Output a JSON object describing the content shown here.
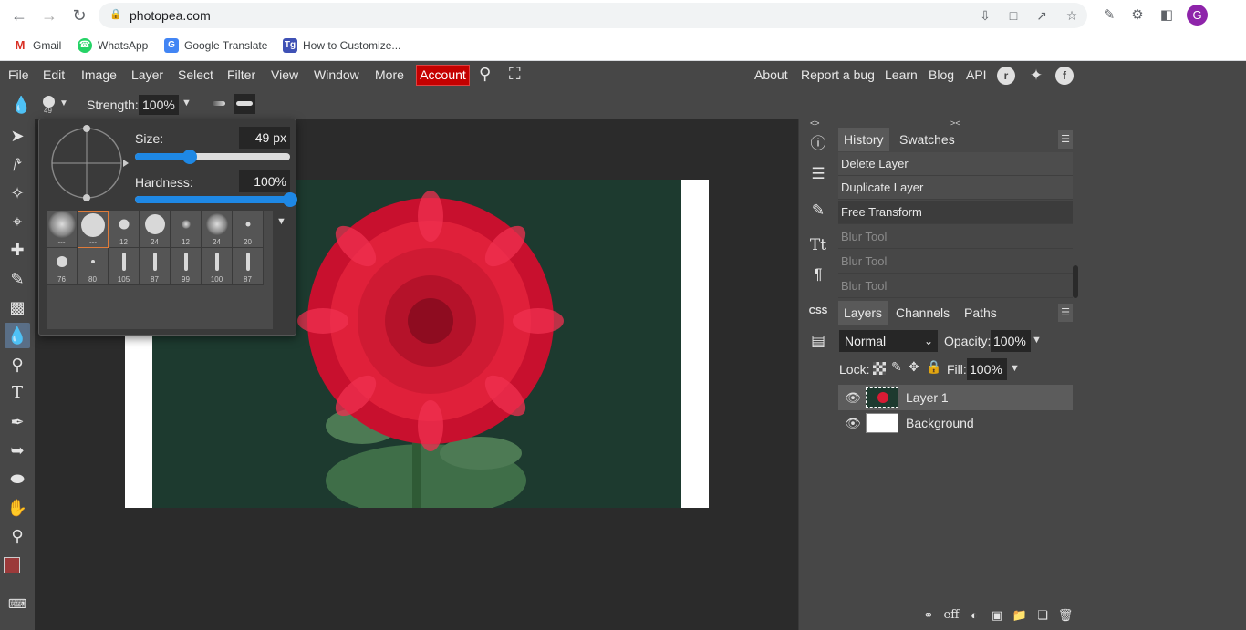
{
  "browser": {
    "url": "photopea.com",
    "profile_initial": "G",
    "bookmarks": [
      {
        "label": "Gmail",
        "icon": "gmail-icon"
      },
      {
        "label": "WhatsApp",
        "icon": "whatsapp-icon"
      },
      {
        "label": "Google Translate",
        "icon": "google-translate-icon"
      },
      {
        "label": "How to Customize...",
        "icon": "tg-icon"
      }
    ]
  },
  "menu": {
    "items": [
      "File",
      "Edit",
      "Image",
      "Layer",
      "Select",
      "Filter",
      "View",
      "Window",
      "More"
    ],
    "account": "Account",
    "right_links": [
      "About",
      "Report a bug",
      "Learn",
      "Blog",
      "API"
    ]
  },
  "options": {
    "brush_size_badge": "49",
    "strength_label": "Strength:",
    "strength_value": "100%"
  },
  "brush_popup": {
    "size_label": "Size:",
    "size_value": "49  px",
    "size_fraction": 0.35,
    "hardness_label": "Hardness:",
    "hardness_value": "100%",
    "hardness_fraction": 1.0,
    "presets": [
      "---",
      "---",
      "12",
      "24",
      "12",
      "24",
      "20",
      "76",
      "80",
      "105",
      "87",
      "99",
      "100",
      "87"
    ]
  },
  "history": {
    "tabs": [
      "History",
      "Swatches"
    ],
    "rows": [
      "Delete Layer",
      "Duplicate Layer",
      "Free Transform",
      "Blur Tool",
      "Blur Tool",
      "Blur Tool"
    ]
  },
  "layers": {
    "tabs": [
      "Layers",
      "Channels",
      "Paths"
    ],
    "blend_mode": "Normal",
    "opacity_label": "Opacity:",
    "opacity_value": "100%",
    "lock_label": "Lock:",
    "fill_label": "Fill:",
    "fill_value": "100%",
    "items": [
      {
        "name": "Layer 1",
        "selected": true
      },
      {
        "name": "Background",
        "selected": false
      }
    ]
  },
  "colors": {
    "foreground": "#9b3a3a",
    "background": "#000000",
    "accent": "#c40000"
  }
}
